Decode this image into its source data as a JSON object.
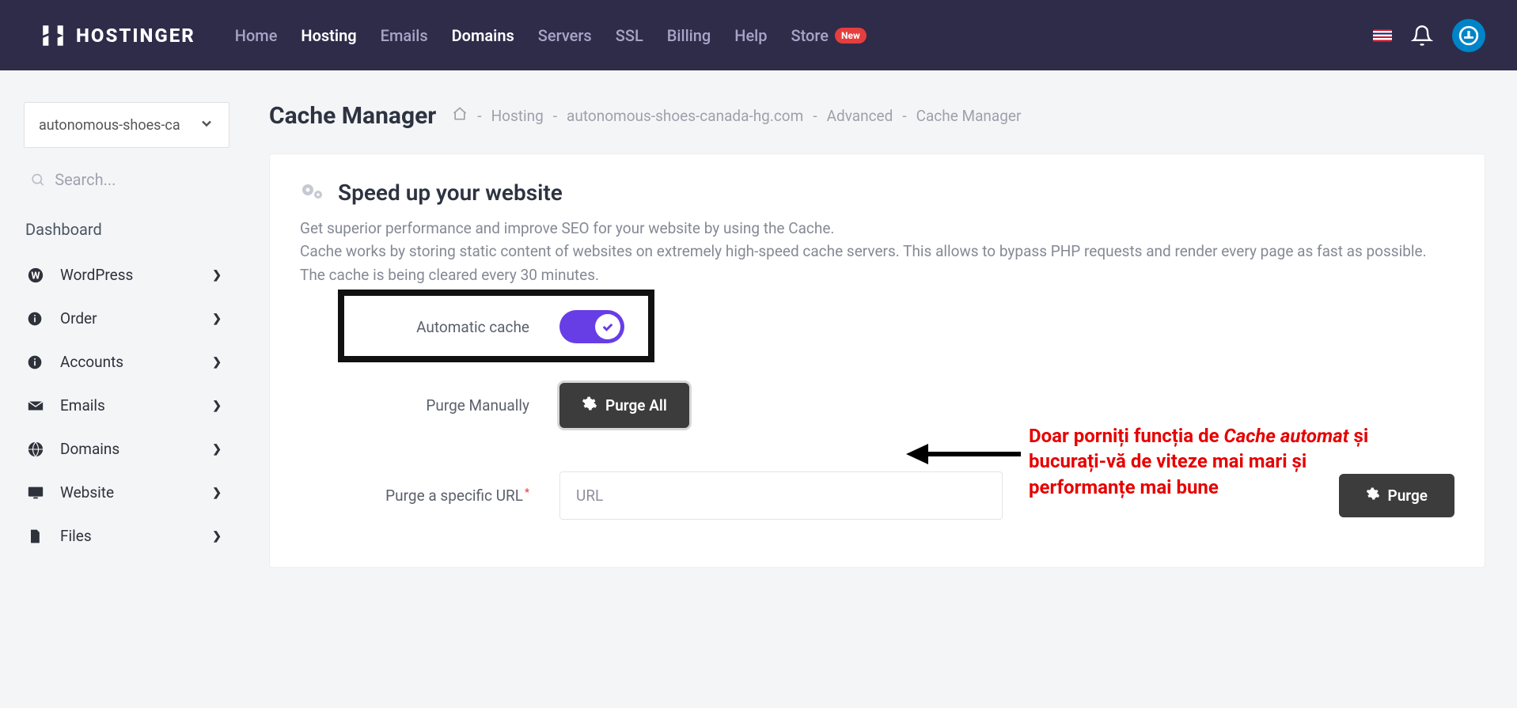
{
  "brand": {
    "name": "HOSTINGER"
  },
  "nav": {
    "items": [
      {
        "label": "Home",
        "active": false
      },
      {
        "label": "Hosting",
        "active": true
      },
      {
        "label": "Emails",
        "active": false
      },
      {
        "label": "Domains",
        "active": true
      },
      {
        "label": "Servers",
        "active": false
      },
      {
        "label": "SSL",
        "active": false
      },
      {
        "label": "Billing",
        "active": false
      },
      {
        "label": "Help",
        "active": false
      },
      {
        "label": "Store",
        "active": false,
        "badge": "New"
      }
    ]
  },
  "sidebar": {
    "domain_selected": "autonomous-shoes-ca",
    "search_placeholder": "Search...",
    "dashboard_label": "Dashboard",
    "items": [
      {
        "label": "WordPress"
      },
      {
        "label": "Order"
      },
      {
        "label": "Accounts"
      },
      {
        "label": "Emails"
      },
      {
        "label": "Domains"
      },
      {
        "label": "Website"
      },
      {
        "label": "Files"
      }
    ]
  },
  "breadcrumb": {
    "title": "Cache Manager",
    "items": [
      "Hosting",
      "autonomous-shoes-canada-hg.com",
      "Advanced",
      "Cache Manager"
    ]
  },
  "card": {
    "title": "Speed up your website",
    "desc_line1": "Get superior performance and improve SEO for your website by using the Cache.",
    "desc_line2": "Cache works by storing static content of websites on extremely high-speed cache servers. This allows to bypass PHP requests and render every page as fast as possible.",
    "desc_line3": "The cache is being cleared every 30 minutes.",
    "row_auto_label": "Automatic cache",
    "row_purge_label": "Purge Manually",
    "row_url_label": "Purge a specific URL",
    "purge_all_btn": "Purge All",
    "purge_btn": "Purge",
    "url_placeholder": "URL",
    "toggle_on": true
  },
  "annotation": {
    "part1": "Doar porniți funcția de ",
    "italic": "Cache automat",
    "part2": " și bucurați-vă de viteze mai mari și performanțe mai bune"
  }
}
